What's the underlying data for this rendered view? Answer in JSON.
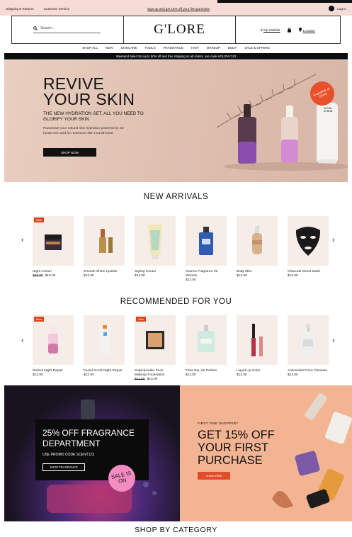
{
  "topbar": {
    "shipping_returns": "Shipping & Returns",
    "customer_service": "Customer Service",
    "signup": "Sign up and get 15% off your first purchase",
    "login": "Log In"
  },
  "header": {
    "search_placeholder": "Search...",
    "logo": "G'LORE",
    "wishlist": "My Wishlist",
    "location": "Location"
  },
  "nav": [
    "SHOP ALL",
    "NEW",
    "SKINCARE",
    "TOOLS",
    "FRAGRANCE",
    "HAIR",
    "MAKEUP",
    "BODY",
    "SALE & OFFERS"
  ],
  "promo_bar": "Weekend Sale! Get up to 50% off and free shipping on all orders, use code HOLIDAY123",
  "hero": {
    "title_line1": "REVIVE",
    "title_line2": "YOUR SKIN",
    "subtitle": "THE NEW HYDRATION SET, ALL YOU NEED TO GLORIFY YOUR SKIN",
    "body": "Reactivate your natural skin hydration powered by 4D hyaluronic acid for maximum skin nourishment",
    "button": "SHOP NOW",
    "badge": "Exclusive at G'lore",
    "product_label": "FACIAL SCRUB"
  },
  "sections": {
    "new_arrivals": "NEW ARRIVALS",
    "recommended": "RECOMMENDED FOR YOU",
    "shop_by_category": "SHOP BY CATEGORY"
  },
  "new_arrivals": [
    {
      "name": "Night Cream",
      "tag": "Sale",
      "old_price": "$40.00",
      "price": "$10.00",
      "icon": "jar"
    },
    {
      "name": "Smooth Shine Lipstick",
      "tag": "",
      "old_price": "",
      "price": "$12.00",
      "icon": "lipstick"
    },
    {
      "name": "Styling Cream",
      "tag": "",
      "old_price": "",
      "price": "$12.00",
      "icon": "tube"
    },
    {
      "name": "Grance Fragrance for Women",
      "tag": "",
      "old_price": "",
      "price": "$12.00",
      "icon": "perfume"
    },
    {
      "name": "Body Mist",
      "tag": "",
      "old_price": "",
      "price": "$12.00",
      "icon": "mist"
    },
    {
      "name": "Charcoal Sheet Mask",
      "tag": "",
      "old_price": "",
      "price": "$12.00",
      "icon": "mask"
    }
  ],
  "recommended": [
    {
      "name": "Retinol Night Repair",
      "tag": "New",
      "old_price": "",
      "price": "$12.00",
      "icon": "dropper"
    },
    {
      "name": "Facial Scrub Night Repair",
      "tag": "",
      "old_price": "",
      "price": "$12.00",
      "icon": "tube"
    },
    {
      "name": "Superpowder Face Makeup Foundation",
      "tag": "Sale",
      "old_price": "$12.00",
      "price": "$10.00",
      "icon": "compact"
    },
    {
      "name": "Flore Eau de Parfum",
      "tag": "",
      "old_price": "",
      "price": "$12.00",
      "icon": "parfum"
    },
    {
      "name": "Liquid Lip Color",
      "tag": "",
      "old_price": "",
      "price": "$12.00",
      "icon": "lipgloss"
    },
    {
      "name": "Antioxidant Face Cleanser",
      "tag": "",
      "old_price": "",
      "price": "$12.00",
      "icon": "pump"
    }
  ],
  "banner_left": {
    "title": "25% OFF FRAGRANCE DEPARTMENT",
    "code": "USE PROMO CODE SCENT123",
    "button": "SHOP FRAGRANCE",
    "badge": "SALE IS ON"
  },
  "banner_right": {
    "eyebrow": "FIRST TIME SHOPPER?",
    "title": "GET 15% OFF YOUR FIRST PURCHASE",
    "button": "SUBSCRIBE"
  },
  "colors": {
    "accent": "#e04d28",
    "topbar": "#f6dcd6",
    "hero_bg": "#dfbfb0",
    "sale_badge": "#f48cc3"
  }
}
